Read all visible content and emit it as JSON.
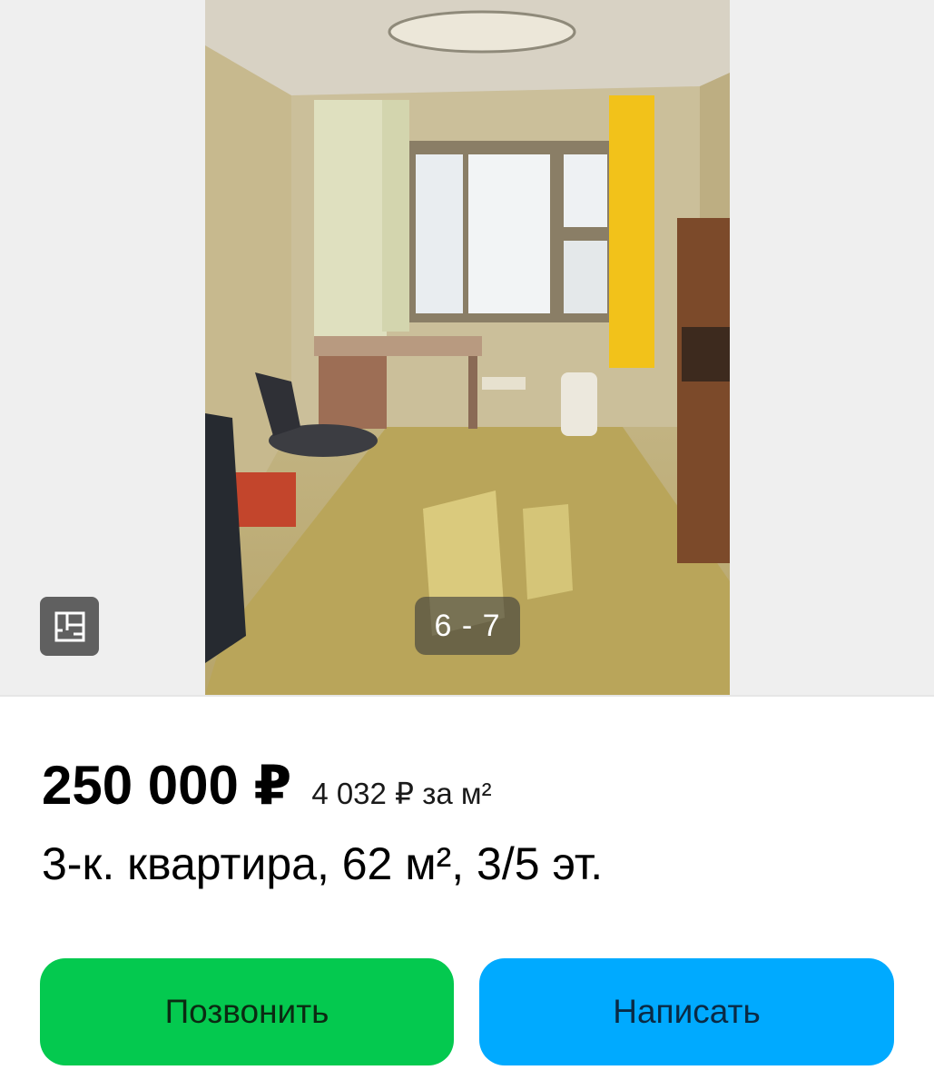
{
  "gallery": {
    "counter": "6 - 7",
    "floorplan_icon": "floorplan-icon",
    "photo": "room-photo"
  },
  "listing": {
    "price": "250 000 ₽",
    "price_per_m2": "4 032 ₽ за м²",
    "title": "3-к. квартира, 62 м², 3/5 эт."
  },
  "actions": {
    "call_label": "Позвонить",
    "write_label": "Написать"
  },
  "colors": {
    "call_button": "#04c94f",
    "write_button": "#00aaff",
    "background": "#ffffff",
    "gallery_background": "#efefef"
  }
}
